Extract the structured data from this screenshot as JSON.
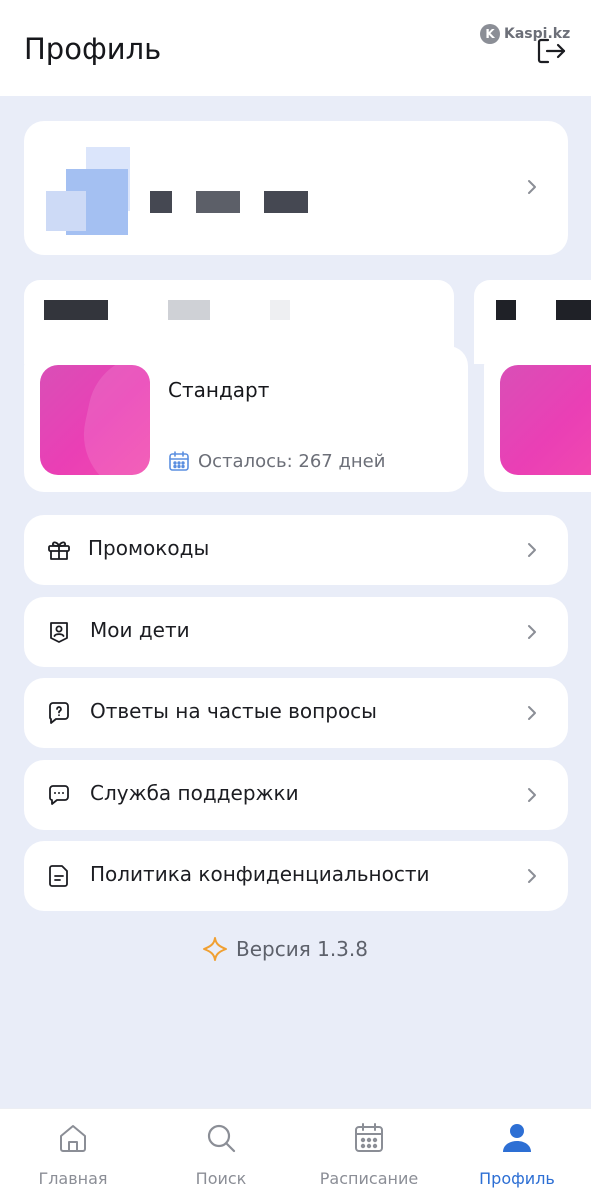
{
  "header": {
    "title": "Профиль",
    "watermark": "Kaspi.kz",
    "watermark_logo": "K"
  },
  "subscription": {
    "name": "Стандарт",
    "remaining": "Осталось: 267 дней"
  },
  "menu": [
    {
      "label": "Промокоды",
      "icon": "gift-icon"
    },
    {
      "label": "Мои дети",
      "icon": "child-icon"
    },
    {
      "label": "Ответы на частые вопросы",
      "icon": "question-bubble-icon"
    },
    {
      "label": "Служба поддержки",
      "icon": "chat-bubble-icon"
    },
    {
      "label": "Политика конфиденциальности",
      "icon": "document-icon"
    }
  ],
  "version": {
    "text": "Версия 1.3.8",
    "icon_color": "#f0a032"
  },
  "tabbar": {
    "items": [
      {
        "label": "Главная",
        "icon": "home-icon"
      },
      {
        "label": "Поиск",
        "icon": "search-icon"
      },
      {
        "label": "Расписание",
        "icon": "calendar-icon"
      },
      {
        "label": "Профиль",
        "icon": "user-icon",
        "active": true
      }
    ]
  },
  "colors": {
    "accent": "#2d6fd4",
    "background": "#e9edf8",
    "thumb": "#e540b4"
  }
}
